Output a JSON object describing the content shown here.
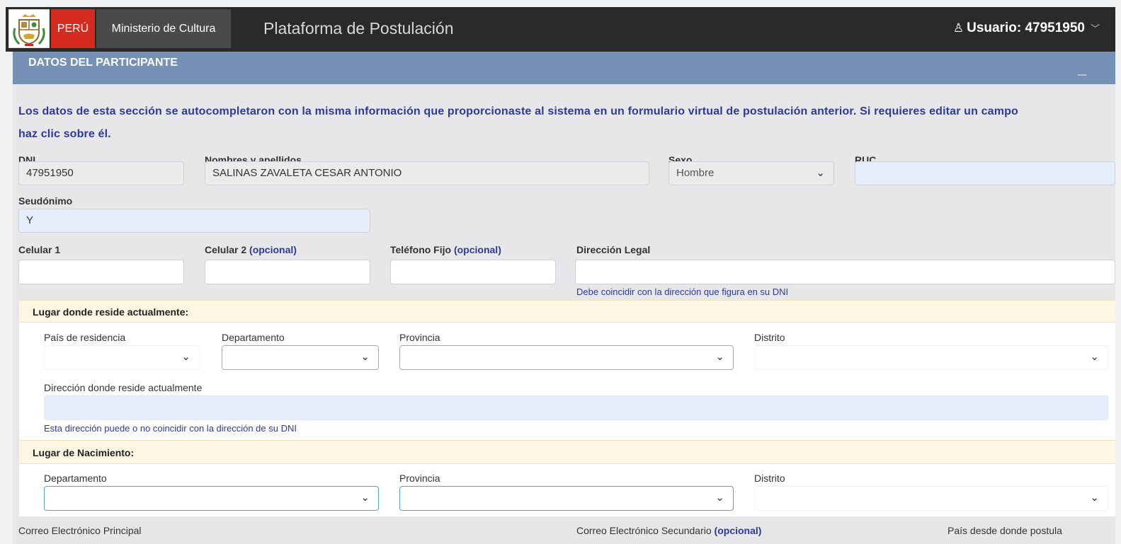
{
  "header": {
    "country": "PERÚ",
    "ministry": "Ministerio de Cultura",
    "platform_title": "Plataforma de Postulación",
    "user_label": "Usuario: 47951950"
  },
  "section": {
    "title": "DATOS DEL PARTICIPANTE",
    "minimize": "_",
    "info_line1": "Los datos de esta sección se autocompletaron con la misma información que proporcionaste al sistema en un formulario virtual de postulación anterior. Si requieres editar un campo",
    "info_line2": "haz clic sobre él."
  },
  "fields": {
    "dni": {
      "label": "DNI",
      "value": "47951950"
    },
    "nombres": {
      "label": "Nombres y apellidos",
      "value": "SALINAS ZAVALETA CESAR ANTONIO"
    },
    "sexo": {
      "label": "Sexo",
      "value": "Hombre"
    },
    "ruc": {
      "label": "RUC",
      "value": ""
    },
    "seudonimo": {
      "label": "Seudónimo",
      "value": "Y"
    },
    "celular1": {
      "label": "Celular 1",
      "value": ""
    },
    "celular2": {
      "label": "Celular 2",
      "optional": "(opcional)",
      "value": ""
    },
    "telefono": {
      "label": "Teléfono Fijo",
      "optional": "(opcional)",
      "value": ""
    },
    "direccion_legal": {
      "label": "Dirección Legal",
      "value": "",
      "hint": "Debe coincidir con la dirección que figura en su DNI"
    }
  },
  "residencia": {
    "title": "Lugar donde reside actualmente:",
    "pais": "País de residencia",
    "departamento": "Departamento",
    "provincia": "Provincia",
    "distrito": "Distrito",
    "direccion_label": "Dirección donde reside actualmente",
    "direccion_hint": "Esta dirección puede o no coincidir con la dirección de su DNI"
  },
  "nacimiento": {
    "title": "Lugar de Nacimiento:",
    "departamento": "Departamento",
    "provincia": "Provincia",
    "distrito": "Distrito"
  },
  "bottom": {
    "correo_principal": "Correo Electrónico Principal",
    "correo_secundario": "Correo Electrónico Secundario",
    "correo_secundario_opt": "(opcional)",
    "pais_postula": "País desde donde postula"
  },
  "icons": {
    "dropdown": "chevron-down-icon",
    "user": "user-icon",
    "emblem": "peru-emblem-icon"
  },
  "colors": {
    "section_header": "#7591b5",
    "info_text": "#2c3a9c",
    "peru_red": "#d52b1e",
    "topbar": "#2a2a2a"
  }
}
